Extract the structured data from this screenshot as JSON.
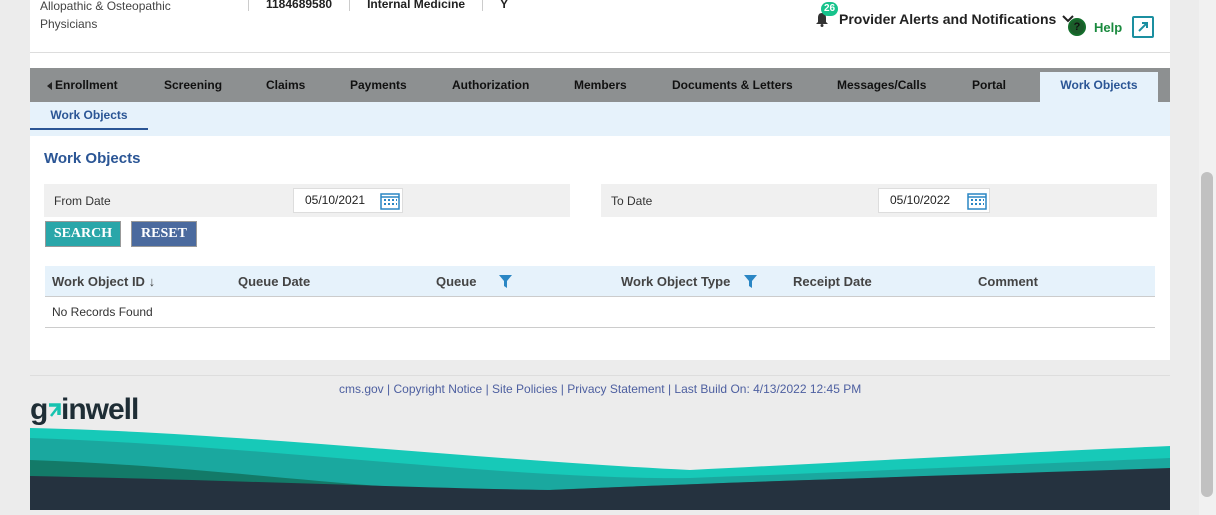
{
  "provider": {
    "type_text": "Allopathic & Osteopathic Physicians",
    "npi": "1184689580",
    "specialty": "Internal Medicine",
    "flag": "Y"
  },
  "header": {
    "alerts_label": "Provider Alerts and Notifications",
    "alerts_count": "26",
    "help_label": "Help",
    "help_icon_text": "?"
  },
  "nav": {
    "items": [
      {
        "label": "Enrollment"
      },
      {
        "label": "Screening"
      },
      {
        "label": "Claims"
      },
      {
        "label": "Payments"
      },
      {
        "label": "Authorization"
      },
      {
        "label": "Members"
      },
      {
        "label": "Documents & Letters"
      },
      {
        "label": "Messages/Calls"
      },
      {
        "label": "Portal"
      },
      {
        "label": "Work Objects"
      }
    ],
    "active": "Work Objects",
    "subnav_label": "Work Objects"
  },
  "page": {
    "title": "Work Objects",
    "from_label": "From Date",
    "from_value": "05/10/2021",
    "to_label": "To Date",
    "to_value": "05/10/2022",
    "search_label": "SEARCH",
    "reset_label": "RESET"
  },
  "grid": {
    "columns": [
      "Work Object ID",
      "Queue Date",
      "Queue",
      "Work Object Type",
      "Receipt Date",
      "Comment"
    ],
    "sort_indicator": "↓",
    "empty_text": "No Records Found"
  },
  "footer": {
    "links": [
      "cms.gov",
      "Copyright Notice",
      "Site Policies",
      "Privacy Statement"
    ],
    "build_text": "Last Build On: 4/13/2022 12:45 PM",
    "separator": "|",
    "logo_text": "gainwell"
  },
  "colors": {
    "accent": "#2a5595",
    "search_btn": "#2aa6a9",
    "reset_btn": "#4b6a9e",
    "nav_bg": "#8d9091",
    "subnav_bg": "#e6f2fb",
    "badge": "#17c38c"
  }
}
